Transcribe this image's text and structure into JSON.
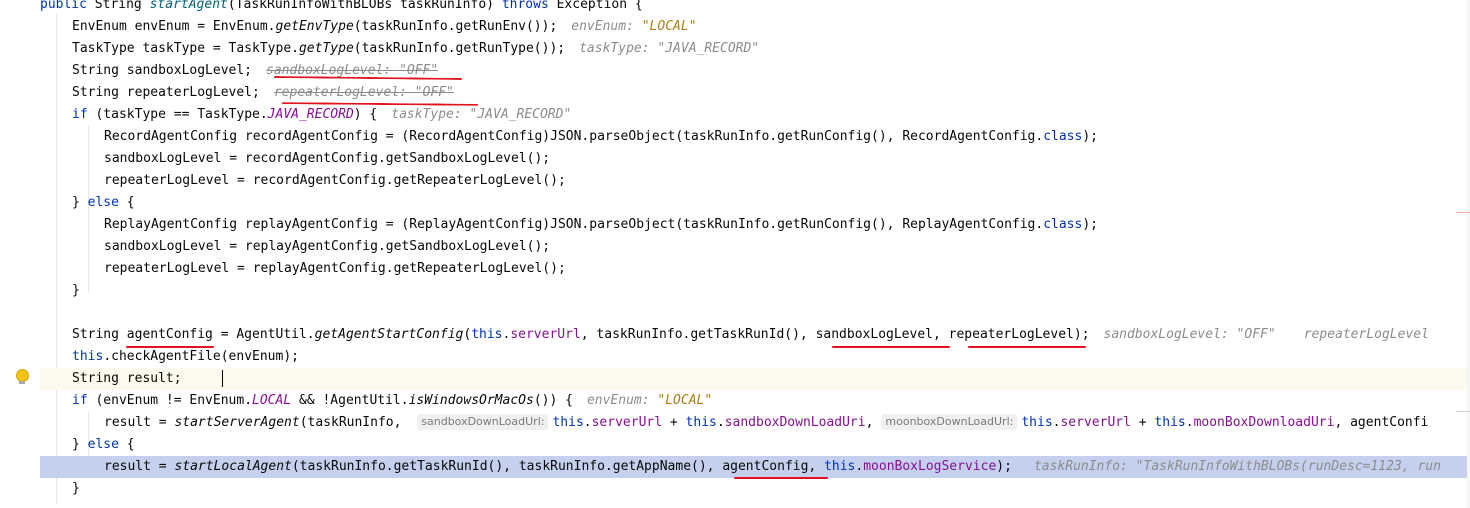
{
  "code_lines": [
    {
      "code": "public String startAgent(TaskRunInfoWithBLOBs taskRunInfo) throws Exception {"
    },
    {
      "code": "EnvEnum envEnum = EnvEnum.getEnvType(taskRunInfo.getRunEnv());",
      "hint": "envEnum: \"LOCAL\""
    },
    {
      "code": "TaskType taskType = TaskType.getType(taskRunInfo.getRunType());",
      "hint": "taskType: \"JAVA_RECORD\""
    },
    {
      "code": "String sandboxLogLevel;",
      "hint": "sandboxLogLevel: \"OFF\""
    },
    {
      "code": "String repeaterLogLevel;",
      "hint": "repeaterLogLevel: \"OFF\""
    },
    {
      "code": "if (taskType == TaskType.JAVA_RECORD) {",
      "hint": "taskType: \"JAVA_RECORD\""
    },
    {
      "code": "RecordAgentConfig recordAgentConfig = (RecordAgentConfig)JSON.parseObject(taskRunInfo.getRunConfig(), RecordAgentConfig.class);"
    },
    {
      "code": "sandboxLogLevel = recordAgentConfig.getSandboxLogLevel();"
    },
    {
      "code": "repeaterLogLevel = recordAgentConfig.getRepeaterLogLevel();"
    },
    {
      "code": "} else {"
    },
    {
      "code": "ReplayAgentConfig replayAgentConfig = (ReplayAgentConfig)JSON.parseObject(taskRunInfo.getRunConfig(), ReplayAgentConfig.class);"
    },
    {
      "code": "sandboxLogLevel = replayAgentConfig.getSandboxLogLevel();"
    },
    {
      "code": "repeaterLogLevel = replayAgentConfig.getRepeaterLogLevel();"
    },
    {
      "code": "}"
    },
    {
      "code": ""
    },
    {
      "code": "String agentConfig = AgentUtil.getAgentStartConfig(this.serverUrl, taskRunInfo.getTaskRunId(), sandboxLogLevel, repeaterLogLevel);",
      "hint": "sandboxLogLevel: \"OFF\"",
      "hint2": "repeaterLogLevel"
    },
    {
      "code": "this.checkAgentFile(envEnum);"
    },
    {
      "code": "String result;"
    },
    {
      "code": "if (envEnum != EnvEnum.LOCAL && !AgentUtil.isWindowsOrMacOs()) {",
      "hint": "envEnum: \"LOCAL\""
    },
    {
      "code": "result = startServerAgent(taskRunInfo, this.serverUrl + this.sandboxDownLoadUri, this.serverUrl + this.moonBoxDownloadUri, agentConfi",
      "param1": "sandboxDownLoadUrl:",
      "param2": "moonboxDownLoadUrl:"
    },
    {
      "code": "} else {"
    },
    {
      "code": "result = startLocalAgent(taskRunInfo.getTaskRunId(), taskRunInfo.getAppName(), agentConfig, this.moonBoxLogService);",
      "hint": "taskRunInfo: \"TaskRunInfoWithBLOBs(runDesc=1123, run"
    },
    {
      "code": "}"
    }
  ],
  "tokens": {
    "l0": {
      "a": "public",
      "b": " String ",
      "c": "startAgent",
      "d": "(TaskRunInfoWithBLOBs taskRunInfo) ",
      "e": "throws",
      "f": " Exception {"
    },
    "l1": {
      "a": "EnvEnum envEnum = EnvEnum.",
      "b": "getEnvType",
      "c": "(taskRunInfo.getRunEnv());",
      "h1": "envEnum: ",
      "h2": "\"LOCAL\""
    },
    "l2": {
      "a": "TaskType taskType = TaskType.",
      "b": "getType",
      "c": "(taskRunInfo.getRunType());",
      "h1": "taskType: ",
      "h2": "\"JAVA_RECORD\""
    },
    "l3": {
      "a": "String sandboxLogLevel;",
      "h1": "sandboxLogLevel: ",
      "h2": "\"OFF\""
    },
    "l4": {
      "a": "String repeaterLogLevel;",
      "h1": "repeaterLogLevel: ",
      "h2": "\"OFF\""
    },
    "l5": {
      "a": "if",
      "b": " (taskType == TaskType.",
      "c": "JAVA_RECORD",
      "d": ") {",
      "h1": "taskType: ",
      "h2": "\"JAVA_RECORD\""
    },
    "l6": {
      "a": "RecordAgentConfig recordAgentConfig = (RecordAgentConfig)JSON.parseObject(taskRunInfo.getRunConfig(), RecordAgentConfig.",
      "b": "class",
      "c": ");"
    },
    "l7": {
      "a": "sandboxLogLevel = recordAgentConfig.getSandboxLogLevel();"
    },
    "l8": {
      "a": "repeaterLogLevel = recordAgentConfig.getRepeaterLogLevel();"
    },
    "l9": {
      "a": "} ",
      "b": "else",
      "c": " {"
    },
    "l10": {
      "a": "ReplayAgentConfig replayAgentConfig = (ReplayAgentConfig)JSON.parseObject(taskRunInfo.getRunConfig(), ReplayAgentConfig.",
      "b": "class",
      "c": ");"
    },
    "l11": {
      "a": "sandboxLogLevel = replayAgentConfig.getSandboxLogLevel();"
    },
    "l12": {
      "a": "repeaterLogLevel = replayAgentConfig.getRepeaterLogLevel();"
    },
    "l13": {
      "a": "}"
    },
    "l15": {
      "a": "String agentConfig = AgentUtil.",
      "b": "getAgentStartConfig",
      "c": "(",
      "d": "this",
      "e": ".",
      "f": "serverUrl",
      "g": ", taskRunInfo.getTaskRunId(), sandboxLogLevel, repeaterLogLevel);",
      "h1": "sandboxLogLevel: ",
      "h2": "\"OFF\"",
      "h3": "repeaterLogLevel"
    },
    "l16": {
      "a": "this",
      "b": ".checkAgentFile(envEnum);"
    },
    "l17": {
      "a": "String result;"
    },
    "l18": {
      "a": "if",
      "b": " (envEnum != EnvEnum.",
      "c": "LOCAL",
      "d": " && !AgentUtil.",
      "e": "isWindowsOrMacOs",
      "f": "()) {",
      "h1": "envEnum: ",
      "h2": "\"LOCAL\""
    },
    "l19": {
      "a": "result = ",
      "b": "startServerAgent",
      "c": "(taskRunInfo, ",
      "p1": "sandboxDownLoadUrl:",
      "d": "this",
      "e": ".",
      "f": "serverUrl",
      "g": " + ",
      "h": "this",
      "i": ".",
      "j": "sandboxDownLoadUri",
      "k": ",",
      "p2": "moonboxDownLoadUrl:",
      "l": "this",
      "m": ".",
      "n": "serverUrl",
      "o": " + ",
      "p": "this",
      "q": ".",
      "r": "moonBoxDownloadUri",
      "s": ", agentConfi"
    },
    "l20": {
      "a": "} ",
      "b": "else",
      "c": " {"
    },
    "l21": {
      "a": "result = ",
      "b": "startLocalAgent",
      "c": "(taskRunInfo.getTaskRunId(), taskRunInfo.getAppName(), agentConfig, ",
      "d": "this",
      "e": ".",
      "f": "moonBoxLogService",
      "g": ");",
      "h1": "taskRunInfo: \"TaskRunInfoWithBLOBs(runDesc=1123, run"
    },
    "l22": {
      "a": "}"
    }
  },
  "colors": {
    "keyword": "#0033b3",
    "field": "#871094",
    "hint": "#8c8c8c",
    "hint_string": "#b07c10",
    "execution_line": "#c4d0ee",
    "caret_line": "#fcfaed",
    "annotation_red": "#e0141e"
  },
  "icons": [
    "lightbulb-icon"
  ]
}
